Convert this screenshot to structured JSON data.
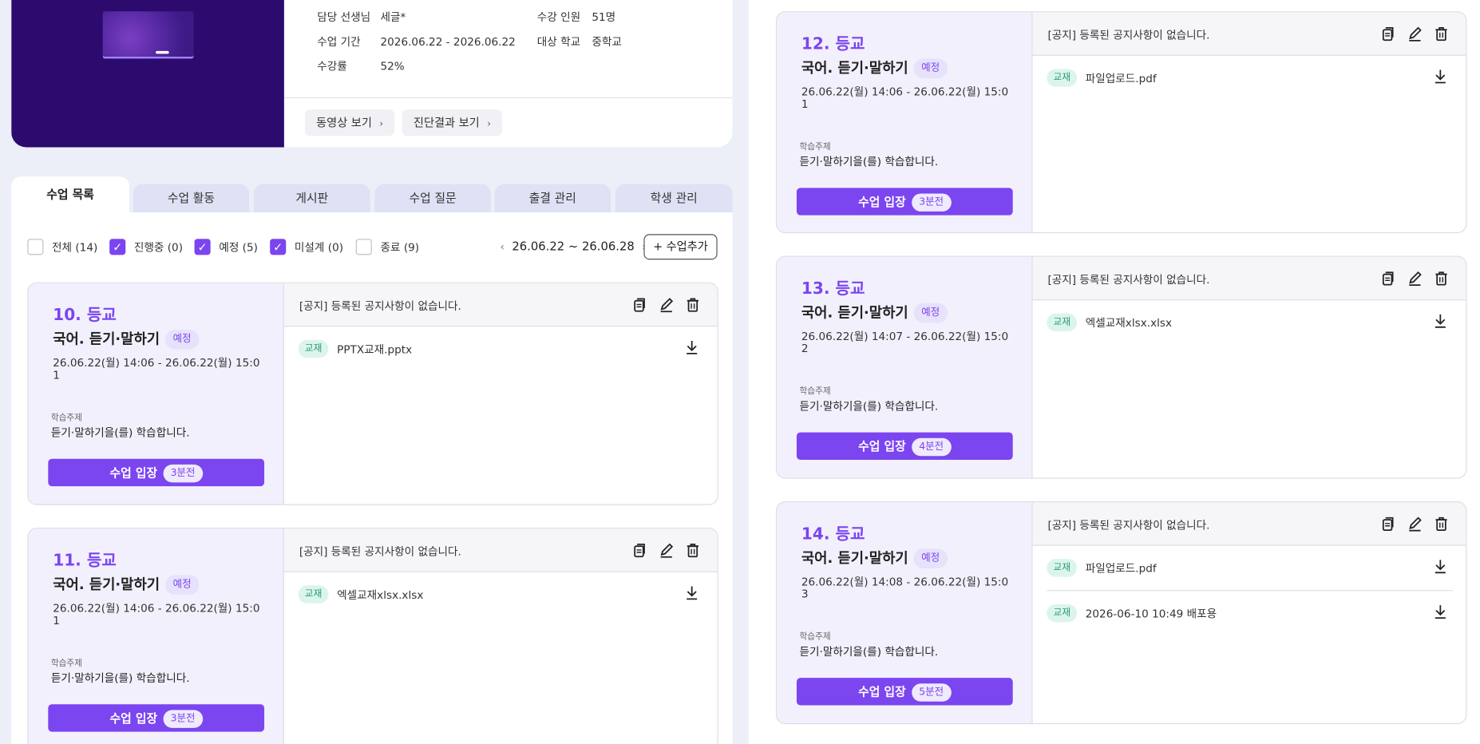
{
  "info": {
    "rows": [
      {
        "label": "담당 선생님",
        "value": "세글*"
      },
      {
        "label": "수강 인원",
        "value": "51명"
      },
      {
        "label": "수업 기간",
        "value": "2026.06.22 - 2026.06.22"
      },
      {
        "label": "대상 학교",
        "value": "중학교"
      },
      {
        "label": "수강률",
        "value": "52%"
      }
    ],
    "buttons": {
      "video": "동영상 보기",
      "diagnosis": "진단결과 보기"
    }
  },
  "tabs": [
    "수업 목록",
    "수업 활동",
    "게시판",
    "수업 질문",
    "출결 관리",
    "학생 관리"
  ],
  "filters": [
    {
      "label": "전체 (14)",
      "checked": false
    },
    {
      "label": "진행중 (0)",
      "checked": true
    },
    {
      "label": "예정 (5)",
      "checked": true
    },
    {
      "label": "미설계 (0)",
      "checked": true
    },
    {
      "label": "종료 (9)",
      "checked": false
    }
  ],
  "date_range": "26.06.22 ~ 26.06.28",
  "add_button": "+ 수업추가",
  "common": {
    "notice": "[공지] 등록된 공지사항이 없습니다.",
    "topic_label": "학습주제",
    "topic": "듣기·말하기을(를) 학습합니다.",
    "subject": "국어. 듣기·말하기",
    "status": "예정",
    "enter": "수업 입장",
    "material_tag": "교재"
  },
  "cards": [
    {
      "num": "10. 등교",
      "time": "26.06.22(월) 14:06 - 26.06.22(월) 15:01",
      "minutes": "3분전",
      "files": [
        "PPTX교재.pptx"
      ]
    },
    {
      "num": "11. 등교",
      "time": "26.06.22(월) 14:06 - 26.06.22(월) 15:01",
      "minutes": "3분전",
      "files": [
        "엑셀교재xlsx.xlsx"
      ]
    },
    {
      "num": "12. 등교",
      "time": "26.06.22(월) 14:06 - 26.06.22(월) 15:01",
      "minutes": "3분전",
      "files": [
        "파일업로드.pdf"
      ]
    },
    {
      "num": "13. 등교",
      "time": "26.06.22(월) 14:07 - 26.06.22(월) 15:02",
      "minutes": "4분전",
      "files": [
        "엑셀교재xlsx.xlsx"
      ]
    },
    {
      "num": "14. 등교",
      "time": "26.06.22(월) 14:08 - 26.06.22(월) 15:03",
      "minutes": "5분전",
      "files": [
        "파일업로드.pdf",
        "2026-06-10 10:49 배포용"
      ]
    }
  ],
  "colors": {
    "accent": "#7b45f0",
    "tag_bg": "#dcf5ec",
    "tag_fg": "#2a9d6f"
  }
}
